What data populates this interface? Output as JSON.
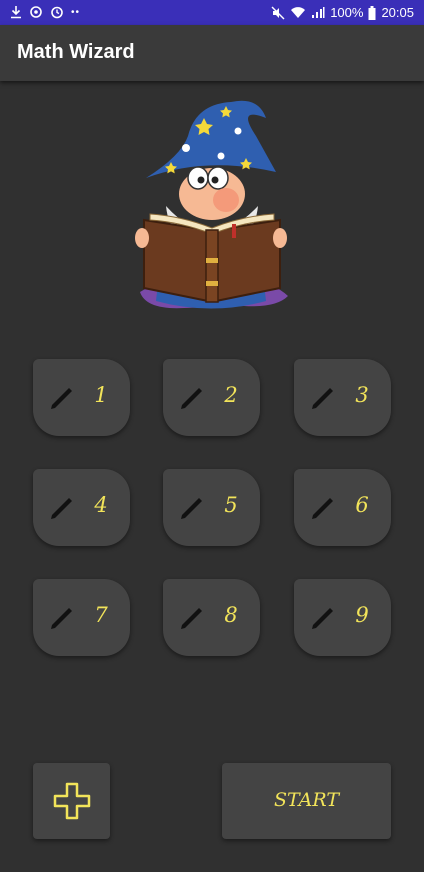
{
  "status_bar": {
    "battery": "100%",
    "time": "20:05",
    "left_icons": [
      "download-icon",
      "sync-icon",
      "timer-icon",
      "more-dots-icon"
    ],
    "right_icons": [
      "mute-icon",
      "wifi-icon",
      "signal-icon",
      "battery-icon"
    ]
  },
  "app_bar": {
    "title": "Math Wizard"
  },
  "colors": {
    "status_bar": "#3a2fb8",
    "app_bar": "#3a3a3a",
    "background": "#303030",
    "tile": "#444444",
    "accent_yellow": "#f2e45a"
  },
  "levels": {
    "items": [
      {
        "label": "1",
        "icon": "pencil-icon"
      },
      {
        "label": "2",
        "icon": "pencil-icon"
      },
      {
        "label": "3",
        "icon": "pencil-icon"
      },
      {
        "label": "4",
        "icon": "pencil-icon"
      },
      {
        "label": "5",
        "icon": "pencil-icon"
      },
      {
        "label": "6",
        "icon": "pencil-icon"
      },
      {
        "label": "7",
        "icon": "pencil-icon"
      },
      {
        "label": "8",
        "icon": "pencil-icon"
      },
      {
        "label": "9",
        "icon": "pencil-icon"
      }
    ]
  },
  "controls": {
    "operation_icon": "plus-icon",
    "start_label": "START"
  }
}
